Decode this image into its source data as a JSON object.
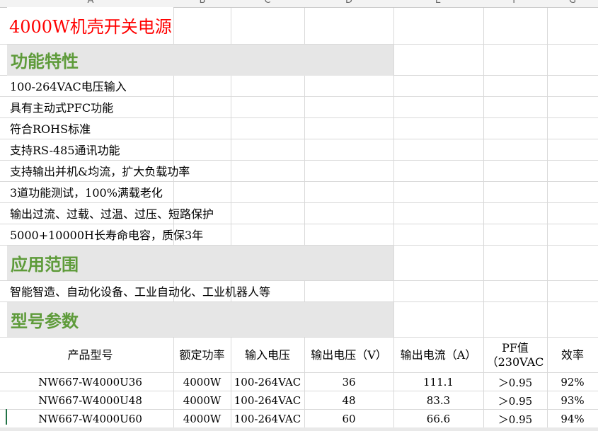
{
  "column_headers": [
    "A",
    "B",
    "C",
    "D",
    "E",
    "F",
    "G"
  ],
  "title": "4000W机壳开关电源",
  "sections": {
    "features": "功能特性",
    "application": "应用范围",
    "models": "型号参数"
  },
  "features": [
    "100-264VAC电压输入",
    "具有主动式PFC功能",
    "符合ROHS标准",
    "支持RS-485通讯功能",
    "支持输出并机&均流，扩大负载功率",
    "3道功能测试，100%满载老化",
    "输出过流、过载、过温、过压、短路保护",
    "5000+10000H长寿命电容，质保3年"
  ],
  "application_text": "智能智造、自动化设备、工业自动化、工业机器人等",
  "table": {
    "headers": [
      "产品型号",
      "额定功率",
      "输入电压",
      "输出电压（V）",
      "输出电流（A）",
      "PF值（230VAC",
      "效率"
    ],
    "pf_header_line1": "PF值",
    "pf_header_line2": "（230VAC",
    "rows": [
      [
        "NW667-W4000U36",
        "4000W",
        "100-264VAC",
        "36",
        "111.1",
        "＞0.95",
        "92%"
      ],
      [
        "NW667-W4000U48",
        "4000W",
        "100-264VAC",
        "48",
        "83.3",
        "＞0.95",
        "93%"
      ],
      [
        "NW667-W4000U60",
        "4000W",
        "100-264VAC",
        "60",
        "66.6",
        "＞0.95",
        "94%"
      ]
    ]
  }
}
